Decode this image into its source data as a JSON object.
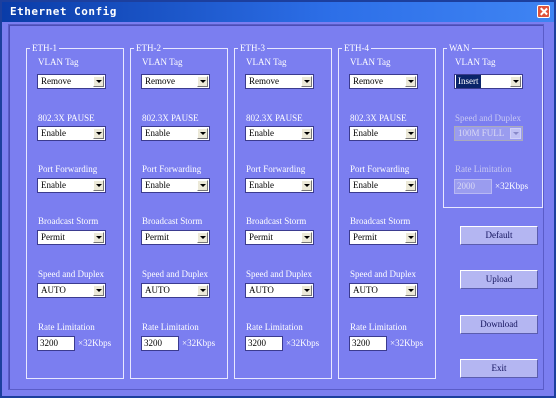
{
  "window": {
    "title": "Ethernet Config"
  },
  "labels": {
    "vlan_tag": "VLAN Tag",
    "pause": "802.3X PAUSE",
    "port_forwarding": "Port Forwarding",
    "broadcast_storm": "Broadcast Storm",
    "speed_duplex": "Speed and Duplex",
    "rate_limitation": "Rate Limitation",
    "unit": "×32Kbps"
  },
  "eth": [
    {
      "name": "ETH-1",
      "vlan_tag": "Remove",
      "pause": "Enable",
      "port_forwarding": "Enable",
      "broadcast_storm": "Permit",
      "speed_duplex": "AUTO",
      "rate": "3200"
    },
    {
      "name": "ETH-2",
      "vlan_tag": "Remove",
      "pause": "Enable",
      "port_forwarding": "Enable",
      "broadcast_storm": "Permit",
      "speed_duplex": "AUTO",
      "rate": "3200"
    },
    {
      "name": "ETH-3",
      "vlan_tag": "Remove",
      "pause": "Enable",
      "port_forwarding": "Enable",
      "broadcast_storm": "Permit",
      "speed_duplex": "AUTO",
      "rate": "3200"
    },
    {
      "name": "ETH-4",
      "vlan_tag": "Remove",
      "pause": "Enable",
      "port_forwarding": "Enable",
      "broadcast_storm": "Permit",
      "speed_duplex": "AUTO",
      "rate": "3200"
    }
  ],
  "wan": {
    "name": "WAN",
    "vlan_tag": "Insert",
    "speed_duplex": "100M FULL",
    "rate": "2000"
  },
  "buttons": {
    "default": "Default",
    "upload": "Upload",
    "download": "Download",
    "exit": "Exit"
  },
  "colors": {
    "background": "#7b7ef0",
    "titlebar": "#0a3ca8",
    "button": "#b4b6f2"
  }
}
